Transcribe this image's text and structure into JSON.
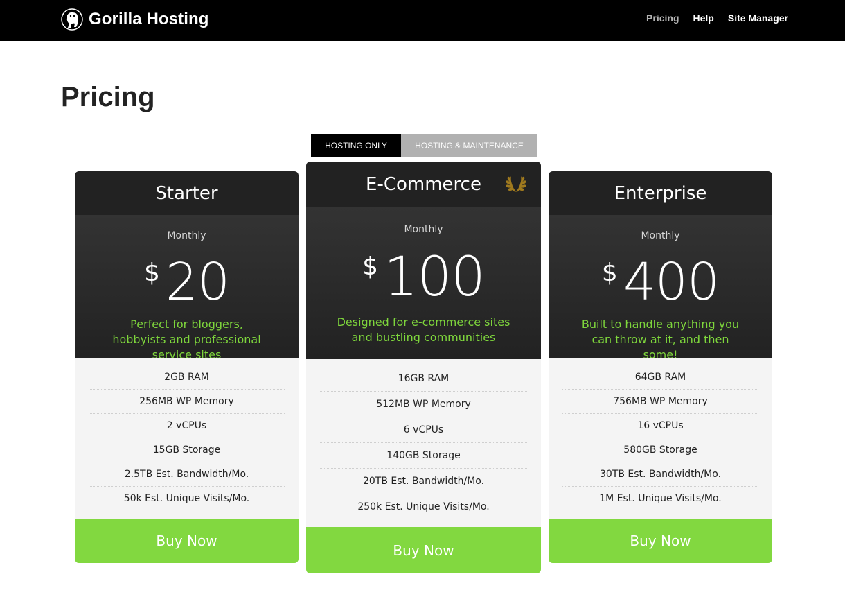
{
  "header": {
    "brand": "Gorilla Hosting",
    "nav": [
      "Pricing",
      "Help",
      "Site Manager"
    ],
    "active_nav": "Pricing"
  },
  "page": {
    "title": "Pricing"
  },
  "tabs": [
    "HOSTING ONLY",
    "HOSTING & MAINTENANCE"
  ],
  "plans": [
    {
      "name": "Starter",
      "period": "Monthly",
      "currency": "$",
      "price": "20",
      "tagline": "Perfect for bloggers, hobbyists and professional service sites",
      "features": [
        "2GB RAM",
        "256MB WP Memory",
        "2 vCPUs",
        "15GB Storage",
        "2.5TB Est. Bandwidth/Mo.",
        "50k Est. Unique Visits/Mo."
      ],
      "cta": "Buy Now"
    },
    {
      "name": "E-Commerce",
      "period": "Monthly",
      "currency": "$",
      "price": "100",
      "tagline": "Designed for e-commerce sites and bustling communities",
      "features": [
        "16GB RAM",
        "512MB WP Memory",
        "6 vCPUs",
        "140GB Storage",
        "20TB Est. Bandwidth/Mo.",
        "250k Est. Unique Visits/Mo."
      ],
      "cta": "Buy Now"
    },
    {
      "name": "Enterprise",
      "period": "Monthly",
      "currency": "$",
      "price": "400",
      "tagline": "Built to handle anything you can throw at it, and then some!",
      "features": [
        "64GB RAM",
        "756MB WP Memory",
        "16 vCPUs",
        "580GB Storage",
        "30TB Est. Bandwidth/Mo.",
        "1M Est. Unique Visits/Mo."
      ],
      "cta": "Buy Now"
    }
  ],
  "colors": {
    "accent_green": "#82d840",
    "tagline_green": "#7ed63c",
    "header_bg": "#000000",
    "card_dark": "#222222",
    "laurel_gold": "#a07a1e"
  },
  "icons": {
    "logo": "gorilla-logo-icon",
    "featured": "laurel-wreath-icon"
  }
}
